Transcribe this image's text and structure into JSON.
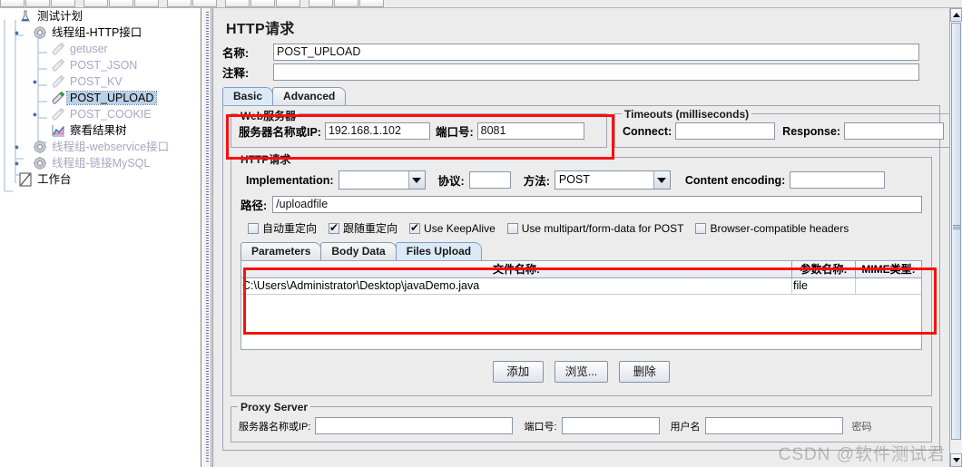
{
  "window": {
    "title": "HTTP请求"
  },
  "toolbar": {
    "button_count": 14
  },
  "tree": {
    "items": [
      {
        "label": "测试计划",
        "icon": "test-plan-icon",
        "indent": 20,
        "twisty": "",
        "state": "normal",
        "line": "root"
      },
      {
        "label": "线程组-HTTP接口",
        "icon": "thread-group-icon",
        "indent": 36,
        "twisty": "expanded",
        "state": "normal",
        "line": "branch"
      },
      {
        "label": "getuser",
        "icon": "http-sampler-icon",
        "indent": 56,
        "twisty": "",
        "state": "disabled",
        "line": "leaf"
      },
      {
        "label": "POST_JSON",
        "icon": "http-sampler-icon",
        "indent": 56,
        "twisty": "",
        "state": "disabled",
        "line": "leaf"
      },
      {
        "label": "POST_KV",
        "icon": "http-sampler-icon",
        "indent": 56,
        "twisty": "collapsed",
        "state": "disabled",
        "line": "leaf"
      },
      {
        "label": "POST_UPLOAD",
        "icon": "http-sampler-active-icon",
        "indent": 56,
        "twisty": "",
        "state": "selected",
        "line": "leaf"
      },
      {
        "label": "POST_COOKIE",
        "icon": "http-sampler-icon",
        "indent": 56,
        "twisty": "collapsed",
        "state": "disabled",
        "line": "leaf"
      },
      {
        "label": "察看结果树",
        "icon": "view-results-tree-icon",
        "indent": 56,
        "twisty": "",
        "state": "normal",
        "line": "last-leaf"
      },
      {
        "label": "线程组-webservice接口",
        "icon": "thread-group-icon",
        "indent": 36,
        "twisty": "collapsed",
        "state": "disabled",
        "line": "branch"
      },
      {
        "label": "线程组-链接MySQL",
        "icon": "thread-group-icon",
        "indent": 36,
        "twisty": "collapsed",
        "state": "disabled",
        "line": "branch"
      },
      {
        "label": "工作台",
        "icon": "workbench-icon",
        "indent": 20,
        "twisty": "",
        "state": "normal",
        "line": "root-last"
      }
    ]
  },
  "header": {
    "name_label": "名称:",
    "name_value": "POST_UPLOAD",
    "comment_label": "注释:",
    "comment_value": ""
  },
  "main_tabs": [
    {
      "label": "Basic",
      "active": true
    },
    {
      "label": "Advanced",
      "active": false
    }
  ],
  "web_server": {
    "group_title": "Web服务器",
    "server_label": "服务器名称或IP:",
    "server_value": "192.168.1.102",
    "port_label": "端口号:",
    "port_value": "8081"
  },
  "timeouts": {
    "group_title": "Timeouts (milliseconds)",
    "connect_label": "Connect:",
    "connect_value": "",
    "response_label": "Response:",
    "response_value": ""
  },
  "http_request": {
    "group_title": "HTTP请求",
    "implementation_label": "Implementation:",
    "implementation_value": "",
    "protocol_label": "协议:",
    "protocol_value": "",
    "method_label": "方法:",
    "method_value": "POST",
    "content_encoding_label": "Content encoding:",
    "content_encoding_value": "",
    "path_label": "路径:",
    "path_value": "/uploadfile",
    "checkboxes": [
      {
        "label": "自动重定向",
        "checked": false
      },
      {
        "label": "跟随重定向",
        "checked": true
      },
      {
        "label": "Use KeepAlive",
        "checked": true
      },
      {
        "label": "Use multipart/form-data for POST",
        "checked": false
      },
      {
        "label": "Browser-compatible headers",
        "checked": false
      }
    ],
    "sub_tabs": [
      {
        "label": "Parameters",
        "active": false
      },
      {
        "label": "Body Data",
        "active": false
      },
      {
        "label": "Files Upload",
        "active": true
      }
    ],
    "files_table": {
      "columns": [
        "文件名称:",
        "参数名称:",
        "MIME类型:"
      ],
      "rows": [
        [
          "C:\\Users\\Administrator\\Desktop\\javaDemo.java",
          "file",
          ""
        ]
      ]
    },
    "buttons": [
      {
        "label": "添加",
        "name": "add-file-button"
      },
      {
        "label": "浏览...",
        "name": "browse-file-button"
      },
      {
        "label": "删除",
        "name": "delete-file-button"
      }
    ]
  },
  "proxy_server": {
    "group_title": "Proxy Server",
    "server_label": "服务器名称或IP:",
    "server_value": "",
    "port_label": "端口号:",
    "port_value": "",
    "username_label": "用户名",
    "username_value": "",
    "password_label": "密码",
    "password_value": ""
  },
  "watermark": {
    "text": "CSDN @软件测试君"
  },
  "colors": {
    "annotation_red": "#fb0f0f",
    "selection_blue": "#b8d0e8",
    "disabled_text": "#a8a6c4",
    "panel_bg": "#ececed"
  }
}
